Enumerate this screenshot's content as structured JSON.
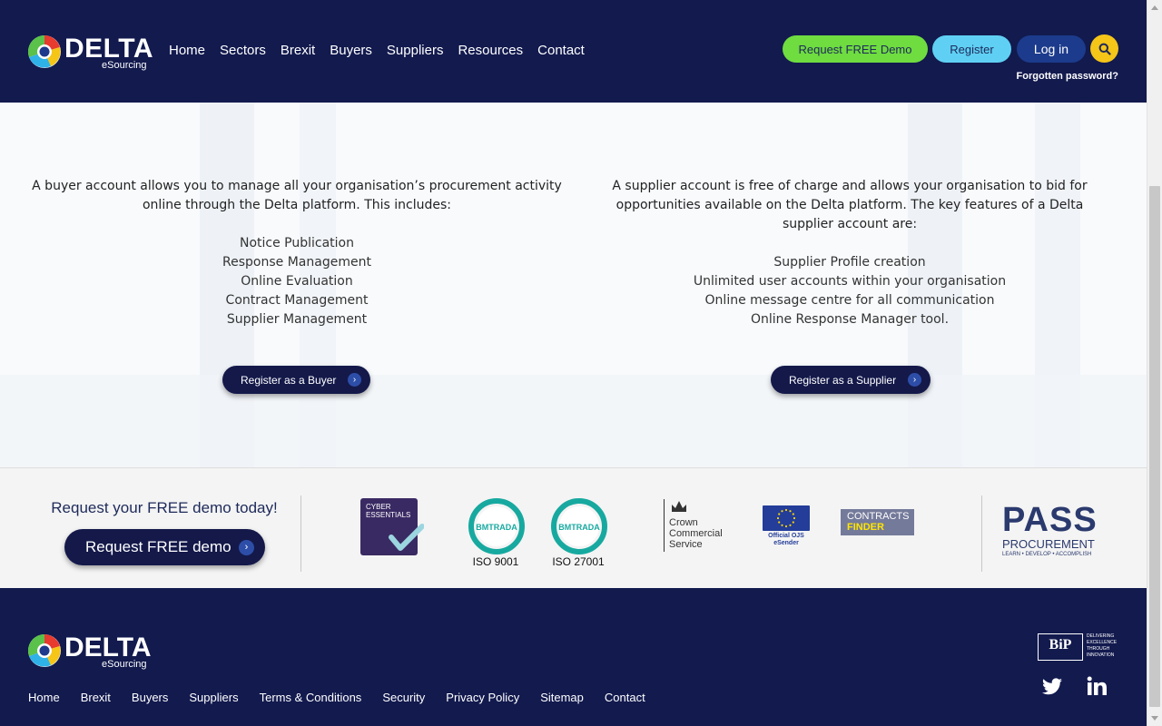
{
  "header": {
    "logo": {
      "word": "DELTA",
      "sub": "eSourcing"
    },
    "nav": [
      "Home",
      "Sectors",
      "Brexit",
      "Buyers",
      "Suppliers",
      "Resources",
      "Contact"
    ],
    "demo_label": "Request FREE Demo",
    "register_label": "Register",
    "login_label": "Log in",
    "forgot_label": "Forgotten password?"
  },
  "buyer": {
    "intro": "A buyer account allows you to manage all your organisation’s procurement activity online through the Delta platform. This includes:",
    "features": [
      "Notice Publication",
      "Response Management",
      "Online Evaluation",
      "Contract Management",
      "Supplier Management"
    ],
    "button": "Register as a Buyer"
  },
  "supplier": {
    "intro": "A supplier account is free of charge and allows your organisation to bid for opportunities available on the Delta platform. The key features of a Delta supplier account are:",
    "features": [
      "Supplier Profile creation",
      "Unlimited user accounts within your organisation",
      "Online message centre for all communication",
      "Online Response Manager tool."
    ],
    "button": "Register as a Supplier"
  },
  "certs": {
    "demo_text": "Request your FREE demo today!",
    "demo_button": "Request FREE demo",
    "cyber": "CYBER ESSENTIALS",
    "bm_text": "BMTRADA",
    "iso1": "ISO 9001",
    "iso2": "ISO 27001",
    "ccs": "Crown Commercial Service",
    "ojs": "Official OJS eSender",
    "cf_a": "CONTRACTS",
    "cf_b": "FINDER",
    "pass_big": "PASS",
    "pass_mid": "PROCUREMENT",
    "pass_small": "LEARN • DEVELOP • ACCOMPLISH"
  },
  "footer": {
    "nav": [
      "Home",
      "Brexit",
      "Buyers",
      "Suppliers",
      "Terms & Conditions",
      "Security",
      "Privacy Policy",
      "Sitemap",
      "Contact"
    ],
    "bip": "BiP",
    "bip_tag": "DELIVERING EXCELLENCE THROUGH INNOVATION"
  },
  "colors": {
    "navy": "#121a4e",
    "green": "#6fdc40",
    "cyan": "#5fd0f4",
    "blue": "#1c3b8c",
    "yellow": "#f5c518",
    "teal": "#17a9a0"
  }
}
